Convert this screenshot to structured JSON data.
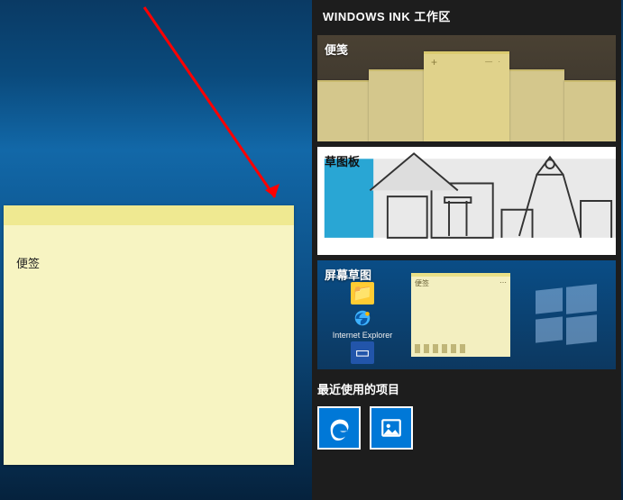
{
  "sticky_note": {
    "content": "便签"
  },
  "ink_panel": {
    "title": "WINDOWS INK 工作区",
    "tiles": {
      "sticky_notes": {
        "label": "便笺"
      },
      "sketchpad": {
        "label": "草图板"
      },
      "screen_sketch": {
        "label": "屏幕草图",
        "ie_label": "Internet Explorer",
        "mini_note": "便签"
      }
    },
    "recent": {
      "title": "最近使用的项目",
      "items": [
        {
          "name": "edge-app"
        },
        {
          "name": "photos-app"
        }
      ]
    }
  }
}
